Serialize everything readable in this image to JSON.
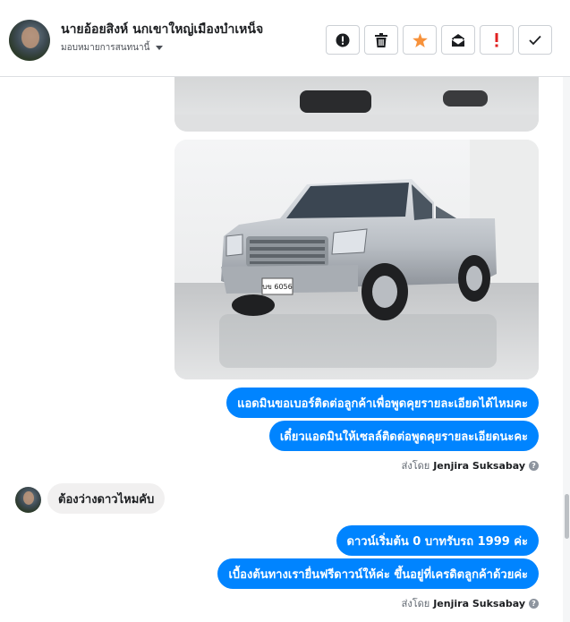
{
  "header": {
    "contact_name": "นายอ้อยสิงห์ นกเขาใหญ่เมืองบำเหน็จ",
    "assign_label": "มอบหมายการสนทนานี้"
  },
  "toolbar": [
    {
      "name": "mark-spam-button",
      "icon": "exclamation-circle-icon"
    },
    {
      "name": "delete-button",
      "icon": "trash-icon"
    },
    {
      "name": "star-button",
      "icon": "star-icon"
    },
    {
      "name": "mark-unread-button",
      "icon": "envelope-icon"
    },
    {
      "name": "flag-button",
      "icon": "exclamation-icon"
    },
    {
      "name": "mark-done-button",
      "icon": "check-icon"
    }
  ],
  "colors": {
    "outgoing_bubble": "#0084ff",
    "incoming_bubble": "#f1f0f0",
    "star": "#f7923b",
    "flag": "#e02020"
  },
  "messages": {
    "out1": "แอดมินขอเบอร์ติดต่อลูกค้าเพื่อพูดคุยรายละเอียดได้ไหมคะ",
    "out2": "เดี๋ยวแอดมินให้เซลล์ติดต่อพูดคุยรายละเอียดนะคะ",
    "sent_by_1": {
      "prefix": "ส่งโดย",
      "name": "Jenjira Suksabay"
    },
    "in1": "ต้องว่างดาวไหมคับ",
    "out3": "ดาวน์เริ่มต้น 0 บาทรับรถ 1999 ค่ะ",
    "out4": "เบื้องต้นทางเรายื่นฟรีดาวน์ให้ค่ะ ขึ้นอยู่ที่เครดิตลูกค้าด้วยค่ะ",
    "sent_by_2": {
      "prefix": "ส่งโดย",
      "name": "Jenjira Suksabay"
    }
  },
  "car_photo": {
    "plate": "บข 6056"
  }
}
